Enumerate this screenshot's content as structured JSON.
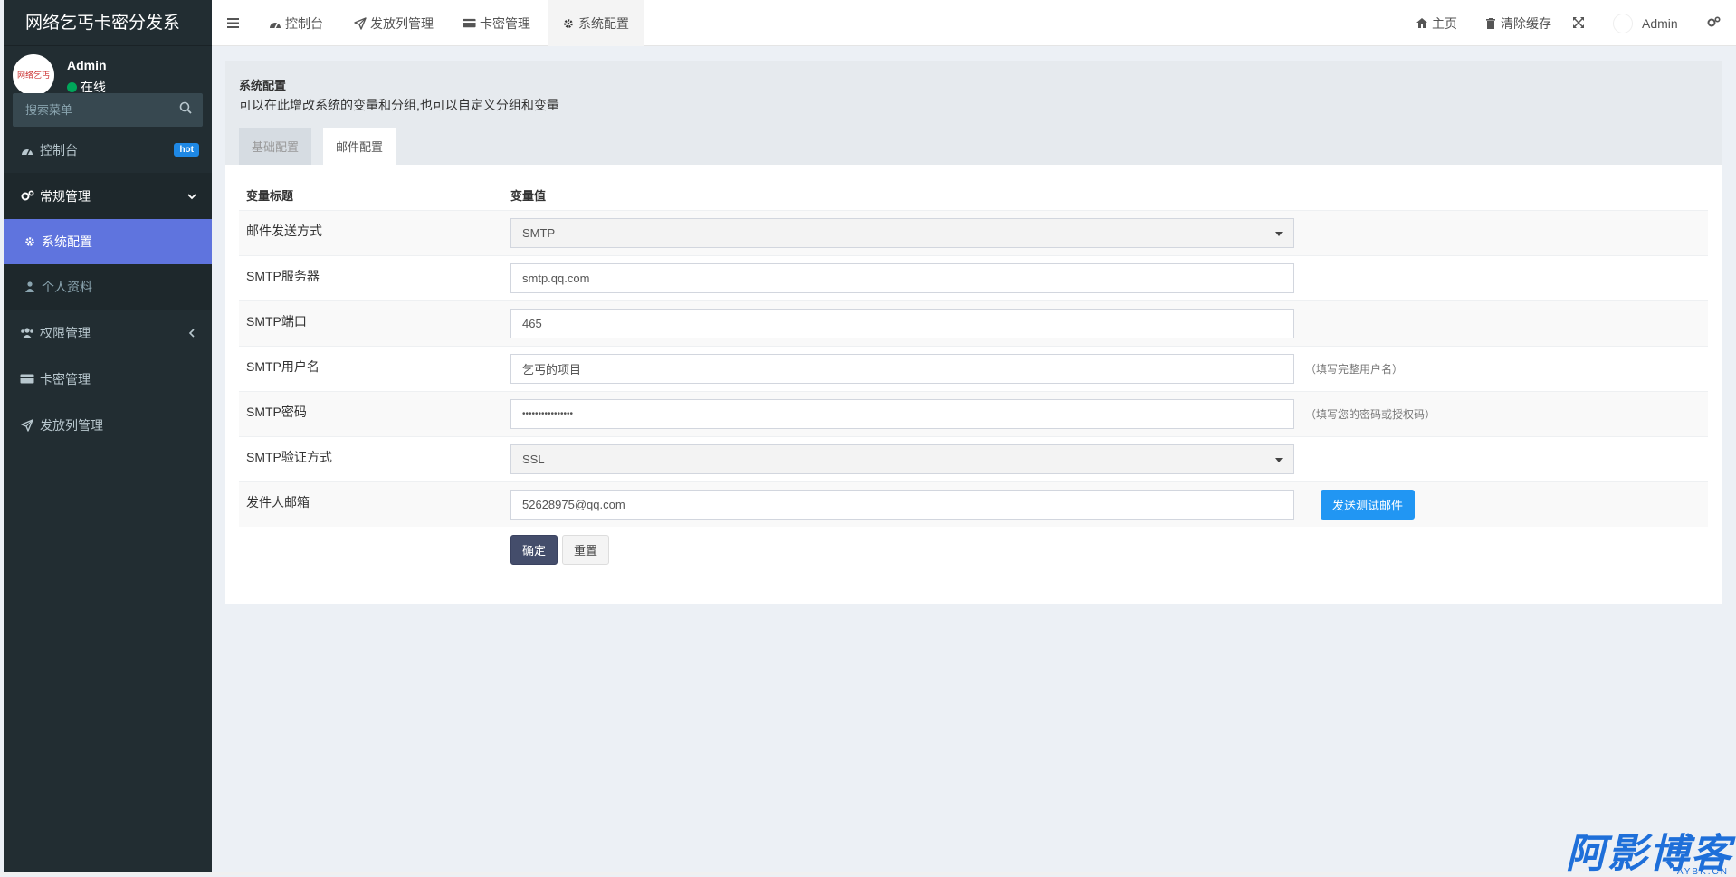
{
  "app": {
    "logo_text": "网络乞丐卡密分发系"
  },
  "user": {
    "name": "Admin",
    "status": "在线",
    "avatar_text": "网络乞丐"
  },
  "search": {
    "placeholder": "搜索菜单"
  },
  "sidebar": {
    "items": [
      {
        "label": "控制台",
        "icon": "dashboard-icon",
        "badge": "hot"
      },
      {
        "label": "常规管理",
        "icon": "cogs-icon",
        "open": true,
        "children": [
          {
            "label": "系统配置",
            "icon": "gear-icon",
            "active": true
          },
          {
            "label": "个人资料",
            "icon": "user-icon"
          }
        ]
      },
      {
        "label": "权限管理",
        "icon": "users-icon"
      },
      {
        "label": "卡密管理",
        "icon": "card-icon"
      },
      {
        "label": "发放列管理",
        "icon": "send-icon"
      }
    ]
  },
  "header": {
    "tabs": [
      {
        "label": "控制台",
        "icon": "dashboard-icon"
      },
      {
        "label": "发放列管理",
        "icon": "send-icon"
      },
      {
        "label": "卡密管理",
        "icon": "card-icon"
      },
      {
        "label": "系统配置",
        "icon": "gear-icon",
        "active": true
      }
    ],
    "right": {
      "home": "主页",
      "clear_cache": "清除缓存",
      "user": "Admin"
    }
  },
  "page": {
    "title": "系统配置",
    "description": "可以在此增改系统的变量和分组,也可以自定义分组和变量",
    "tabs": [
      {
        "label": "基础配置",
        "active": false
      },
      {
        "label": "邮件配置",
        "active": true
      }
    ],
    "table": {
      "col_title": "变量标题",
      "col_value": "变量值",
      "rows": [
        {
          "label": "邮件发送方式",
          "type": "select",
          "value": "SMTP"
        },
        {
          "label": "SMTP服务器",
          "type": "input",
          "value": "smtp.qq.com"
        },
        {
          "label": "SMTP端口",
          "type": "input",
          "value": "465"
        },
        {
          "label": "SMTP用户名",
          "type": "input",
          "value": "乞丐的项目",
          "hint": "（填写完整用户名）"
        },
        {
          "label": "SMTP密码",
          "type": "password",
          "value": "••••••••••••••••",
          "hint": "（填写您的密码或授权码）"
        },
        {
          "label": "SMTP验证方式",
          "type": "select",
          "value": "SSL"
        },
        {
          "label": "发件人邮箱",
          "type": "input",
          "value": "52628975@qq.com"
        }
      ]
    },
    "send_test_button": "发送测试邮件",
    "submit_button": "确定",
    "reset_button": "重置"
  },
  "watermark": {
    "text": "阿影博客",
    "sub": "AYBK.CN"
  },
  "colors": {
    "sidebar_bg": "#222d32",
    "active_menu": "#5f74de",
    "accent_blue": "#2196f3",
    "submit_bg": "#444d6b",
    "online_green": "#00a65a"
  }
}
